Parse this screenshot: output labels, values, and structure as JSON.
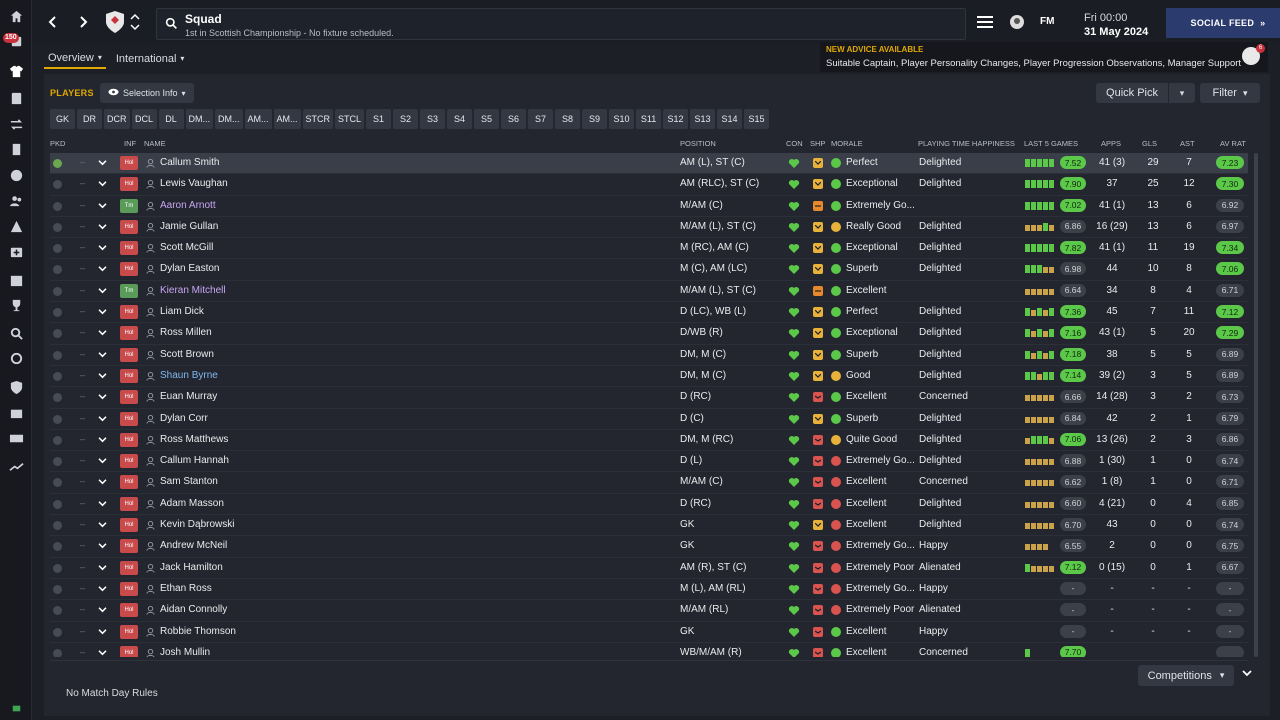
{
  "app": {
    "title": "Squad",
    "subtitle": "1st in Scottish Championship - No fixture scheduled.",
    "fm_label": "FM",
    "date_line1": "Fri 00:00",
    "date_line2": "31 May 2024",
    "social_feed": "SOCIAL FEED",
    "sidebar_badge": "150"
  },
  "tabs": [
    {
      "label": "Overview",
      "active": true
    },
    {
      "label": "International",
      "active": false
    }
  ],
  "advice": {
    "title": "NEW ADVICE AVAILABLE",
    "body": "Suitable Captain, Player Personality Changes, Player Progression Observations, Manager Support",
    "count": "6"
  },
  "toolbar": {
    "players_label": "PLAYERS",
    "selection_info": "Selection Info",
    "quick_pick": "Quick Pick",
    "filter": "Filter"
  },
  "position_chips": [
    "GK",
    "DR",
    "DCR",
    "DCL",
    "DL",
    "DM...",
    "DM...",
    "AM...",
    "AM...",
    "STCR",
    "STCL",
    "S1",
    "S2",
    "S3",
    "S4",
    "S5",
    "S6",
    "S7",
    "S8",
    "S9",
    "S10",
    "S11",
    "S12",
    "S13",
    "S14",
    "S15"
  ],
  "columns": {
    "pkd": "PKD",
    "inf": "INF",
    "name": "NAME",
    "position": "POSITION",
    "con": "CON",
    "shp": "SHP",
    "morale": "MORALE",
    "happiness": "PLAYING TIME HAPPINESS",
    "last5": "LAST 5 GAMES",
    "apps": "APPS",
    "gls": "GLS",
    "ast": "AST",
    "avrat": "AV RAT"
  },
  "players": [
    {
      "name": "Callum Smith",
      "inf": "Hol",
      "pos": "AM (L), ST (C)",
      "shp": "y",
      "mor": "g",
      "morale": "Perfect",
      "hap": "Delighted",
      "l5": "ggggg",
      "l5r": "7.52",
      "l5hi": true,
      "apps": "41 (3)",
      "gls": "29",
      "ast": "7",
      "av": "7.23",
      "avhi": true,
      "sel": true,
      "checked": true
    },
    {
      "name": "Lewis Vaughan",
      "inf": "Hol",
      "pos": "AM (RLC), ST (C)",
      "shp": "y",
      "mor": "g",
      "morale": "Exceptional",
      "hap": "Delighted",
      "l5": "ggggg",
      "l5r": "7.90",
      "l5hi": true,
      "apps": "37",
      "gls": "25",
      "ast": "12",
      "av": "7.30",
      "avhi": true
    },
    {
      "name": "Aaron Arnott",
      "inf": "Tm",
      "pos": "M/AM (C)",
      "shp": "o",
      "mor": "g",
      "morale": "Extremely Go...",
      "hap": "",
      "l5": "ggggg",
      "l5r": "7.02",
      "l5hi": true,
      "apps": "41 (1)",
      "gls": "13",
      "ast": "6",
      "av": "6.92",
      "avhi": false,
      "color": "purple"
    },
    {
      "name": "Jamie Gullan",
      "inf": "Hol",
      "pos": "M/AM (L), ST (C)",
      "shp": "y",
      "mor": "y",
      "morale": "Really Good",
      "hap": "Delighted",
      "l5": "ooogo",
      "l5r": "6.86",
      "l5hi": false,
      "apps": "16 (29)",
      "gls": "13",
      "ast": "6",
      "av": "6.97",
      "avhi": false
    },
    {
      "name": "Scott McGill",
      "inf": "Hol",
      "pos": "M (RC), AM (C)",
      "shp": "y",
      "mor": "g",
      "morale": "Exceptional",
      "hap": "Delighted",
      "l5": "ggggg",
      "l5r": "7.82",
      "l5hi": true,
      "apps": "41 (1)",
      "gls": "11",
      "ast": "19",
      "av": "7.34",
      "avhi": true
    },
    {
      "name": "Dylan Easton",
      "inf": "Hol",
      "pos": "M (C), AM (LC)",
      "shp": "y",
      "mor": "g",
      "morale": "Superb",
      "hap": "Delighted",
      "l5": "gggoo",
      "l5r": "6.98",
      "l5hi": false,
      "apps": "44",
      "gls": "10",
      "ast": "8",
      "av": "7.06",
      "avhi": true
    },
    {
      "name": "Kieran Mitchell",
      "inf": "Tm",
      "pos": "M/AM (L), ST (C)",
      "shp": "o",
      "mor": "g",
      "morale": "Excellent",
      "hap": "",
      "l5": "ooooo",
      "l5r": "6.64",
      "l5hi": false,
      "apps": "34",
      "gls": "8",
      "ast": "4",
      "av": "6.71",
      "avhi": false,
      "color": "purple"
    },
    {
      "name": "Liam Dick",
      "inf": "Hol",
      "pos": "D (LC), WB (L)",
      "shp": "y",
      "mor": "g",
      "morale": "Perfect",
      "hap": "Delighted",
      "l5": "gogog",
      "l5r": "7.36",
      "l5hi": true,
      "apps": "45",
      "gls": "7",
      "ast": "11",
      "av": "7.12",
      "avhi": true
    },
    {
      "name": "Ross Millen",
      "inf": "Hol",
      "pos": "D/WB (R)",
      "shp": "y",
      "mor": "g",
      "morale": "Exceptional",
      "hap": "Delighted",
      "l5": "gogog",
      "l5r": "7.16",
      "l5hi": true,
      "apps": "43 (1)",
      "gls": "5",
      "ast": "20",
      "av": "7.29",
      "avhi": true
    },
    {
      "name": "Scott Brown",
      "inf": "Hol",
      "pos": "DM, M (C)",
      "shp": "y",
      "mor": "g",
      "morale": "Superb",
      "hap": "Delighted",
      "l5": "gogog",
      "l5r": "7.18",
      "l5hi": true,
      "apps": "38",
      "gls": "5",
      "ast": "5",
      "av": "6.89",
      "avhi": false
    },
    {
      "name": "Shaun Byrne",
      "inf": "Hol",
      "pos": "DM, M (C)",
      "shp": "y",
      "mor": "y",
      "morale": "Good",
      "hap": "Delighted",
      "l5": "ggogg",
      "l5r": "7.14",
      "l5hi": true,
      "apps": "39 (2)",
      "gls": "3",
      "ast": "5",
      "av": "6.89",
      "avhi": false,
      "color": "blue"
    },
    {
      "name": "Euan Murray",
      "inf": "Hol",
      "pos": "D (RC)",
      "shp": "r",
      "mor": "g",
      "morale": "Excellent",
      "hap": "Concerned",
      "l5": "ooooo",
      "l5r": "6.66",
      "l5hi": false,
      "apps": "14 (28)",
      "gls": "3",
      "ast": "2",
      "av": "6.73",
      "avhi": false
    },
    {
      "name": "Dylan Corr",
      "inf": "Hol",
      "pos": "D (C)",
      "shp": "y",
      "mor": "g",
      "morale": "Superb",
      "hap": "Delighted",
      "l5": "ooooo",
      "l5r": "6.84",
      "l5hi": false,
      "apps": "42",
      "gls": "2",
      "ast": "1",
      "av": "6.79",
      "avhi": false
    },
    {
      "name": "Ross Matthews",
      "inf": "Hol",
      "pos": "DM, M (RC)",
      "shp": "r",
      "mor": "y",
      "morale": "Quite Good",
      "hap": "Delighted",
      "l5": "ogggo",
      "l5r": "7.06",
      "l5hi": true,
      "apps": "13 (26)",
      "gls": "2",
      "ast": "3",
      "av": "6.86",
      "avhi": false
    },
    {
      "name": "Callum Hannah",
      "inf": "Hol",
      "pos": "D (L)",
      "shp": "r",
      "mor": "r",
      "morale": "Extremely Go...",
      "hap": "Delighted",
      "l5": "ooooo",
      "l5r": "6.88",
      "l5hi": false,
      "apps": "1 (30)",
      "gls": "1",
      "ast": "0",
      "av": "6.74",
      "avhi": false
    },
    {
      "name": "Sam Stanton",
      "inf": "Hol",
      "pos": "M/AM (C)",
      "shp": "r",
      "mor": "r",
      "morale": "Excellent",
      "hap": "Concerned",
      "l5": "ooooo",
      "l5r": "6.62",
      "l5hi": false,
      "apps": "1 (8)",
      "gls": "1",
      "ast": "0",
      "av": "6.71",
      "avhi": false
    },
    {
      "name": "Adam Masson",
      "inf": "Hol",
      "pos": "D (RC)",
      "shp": "r",
      "mor": "r",
      "morale": "Excellent",
      "hap": "Delighted",
      "l5": "ooooo",
      "l5r": "6.60",
      "l5hi": false,
      "apps": "4 (21)",
      "gls": "0",
      "ast": "4",
      "av": "6.85",
      "avhi": false
    },
    {
      "name": "Kevin Dąbrowski",
      "inf": "Hol",
      "pos": "GK",
      "shp": "y",
      "mor": "r",
      "morale": "Excellent",
      "hap": "Delighted",
      "l5": "ooooo",
      "l5r": "6.70",
      "l5hi": false,
      "apps": "43",
      "gls": "0",
      "ast": "0",
      "av": "6.74",
      "avhi": false
    },
    {
      "name": "Andrew McNeil",
      "inf": "Hol",
      "pos": "GK",
      "shp": "r",
      "mor": "r",
      "morale": "Extremely Go...",
      "hap": "Happy",
      "l5": "oooo",
      "l5r": "6.55",
      "l5hi": false,
      "apps": "2",
      "gls": "0",
      "ast": "0",
      "av": "6.75",
      "avhi": false
    },
    {
      "name": "Jack Hamilton",
      "inf": "Hol",
      "pos": "AM (R), ST (C)",
      "shp": "r",
      "mor": "rd",
      "morale": "Extremely Poor",
      "hap": "Alienated",
      "l5": "goooo",
      "l5r": "7.12",
      "l5hi": true,
      "apps": "0 (15)",
      "gls": "0",
      "ast": "1",
      "av": "6.67",
      "avhi": false
    },
    {
      "name": "Ethan Ross",
      "inf": "Hol",
      "pos": "M (L), AM (RL)",
      "shp": "r",
      "mor": "r",
      "morale": "Extremely Go...",
      "hap": "Happy",
      "l5": "",
      "l5r": "-",
      "l5hi": false,
      "apps": "-",
      "gls": "-",
      "ast": "-",
      "av": "-",
      "avhi": false
    },
    {
      "name": "Aidan Connolly",
      "inf": "Hol",
      "pos": "M/AM (RL)",
      "shp": "r",
      "mor": "rd",
      "morale": "Extremely Poor",
      "hap": "Alienated",
      "l5": "",
      "l5r": "-",
      "l5hi": false,
      "apps": "-",
      "gls": "-",
      "ast": "-",
      "av": "-",
      "avhi": false
    },
    {
      "name": "Robbie Thomson",
      "inf": "Hol",
      "pos": "GK",
      "shp": "r",
      "mor": "g",
      "morale": "Excellent",
      "hap": "Happy",
      "l5": "",
      "l5r": "-",
      "l5hi": false,
      "apps": "-",
      "gls": "-",
      "ast": "-",
      "av": "-",
      "avhi": false
    },
    {
      "name": "Josh Mullin",
      "inf": "Hol",
      "pos": "WB/M/AM (R)",
      "shp": "r",
      "mor": "g",
      "morale": "Excellent",
      "hap": "Concerned",
      "l5": "g",
      "l5r": "7.70",
      "l5hi": true,
      "apps": "",
      "gls": "",
      "ast": "",
      "av": "",
      "avhi": false
    }
  ],
  "footer": {
    "no_match": "No Match Day Rules",
    "competitions": "Competitions"
  },
  "colors": {
    "accent": "#e0a800",
    "good": "#5cc84a",
    "warn": "#e8b13a",
    "bad": "#d9534f",
    "danger": "#c8323c"
  }
}
